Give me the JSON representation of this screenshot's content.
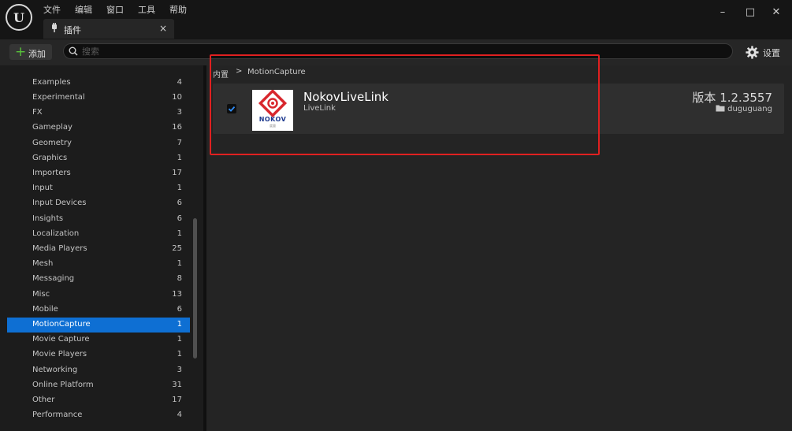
{
  "app": {
    "logo_letter": "U"
  },
  "menu": [
    "文件",
    "编辑",
    "窗口",
    "工具",
    "帮助"
  ],
  "tab": {
    "label": "插件",
    "close": "×"
  },
  "window_controls": {
    "minimize": "–",
    "maximize": "□",
    "close": "✕"
  },
  "toolbar": {
    "add_label": "添加",
    "search_placeholder": "搜索",
    "search_value": "",
    "settings_label": "设置"
  },
  "sidebar": {
    "items": [
      {
        "label": "Examples",
        "count": "4"
      },
      {
        "label": "Experimental",
        "count": "10"
      },
      {
        "label": "FX",
        "count": "3"
      },
      {
        "label": "Gameplay",
        "count": "16"
      },
      {
        "label": "Geometry",
        "count": "7"
      },
      {
        "label": "Graphics",
        "count": "1"
      },
      {
        "label": "Importers",
        "count": "17"
      },
      {
        "label": "Input",
        "count": "1"
      },
      {
        "label": "Input Devices",
        "count": "6"
      },
      {
        "label": "Insights",
        "count": "6"
      },
      {
        "label": "Localization",
        "count": "1"
      },
      {
        "label": "Media Players",
        "count": "25"
      },
      {
        "label": "Mesh",
        "count": "1"
      },
      {
        "label": "Messaging",
        "count": "8"
      },
      {
        "label": "Misc",
        "count": "13"
      },
      {
        "label": "Mobile",
        "count": "6"
      },
      {
        "label": "MotionCapture",
        "count": "1",
        "selected": true
      },
      {
        "label": "Movie Capture",
        "count": "1"
      },
      {
        "label": "Movie Players",
        "count": "1"
      },
      {
        "label": "Networking",
        "count": "3"
      },
      {
        "label": "Online Platform",
        "count": "31"
      },
      {
        "label": "Other",
        "count": "17"
      },
      {
        "label": "Performance",
        "count": "4"
      }
    ]
  },
  "breadcrumb": {
    "root": "内置",
    "separator": ">",
    "current": "MotionCapture"
  },
  "plugin": {
    "name": "NokovLiveLink",
    "category": "LiveLink",
    "version": "版本 1.2.3557",
    "author": "duguguang",
    "enabled": true,
    "logo_text": "NOKOV",
    "logo_subtext": "度量"
  },
  "colors": {
    "accent": "#0e6fd3",
    "add_green": "#58c33a",
    "highlight_box": "#e02020",
    "logo_red": "#d8272d"
  }
}
